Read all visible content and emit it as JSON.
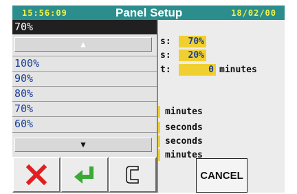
{
  "titlebar": {
    "time": "15:56:09",
    "title": "Panel Setup",
    "date": "18/02/00"
  },
  "background": {
    "row1_suffix": "s:",
    "row1_value": "70%",
    "row2_suffix": "s:",
    "row2_value": "20%",
    "row3_suffix": "t:",
    "row3_value": "0",
    "row3_unit": "minutes",
    "row4_unit": "minutes",
    "row5_unit": "seconds",
    "row6_unit": "seconds",
    "row7_unit": "minutes",
    "cancel_label": "CANCEL"
  },
  "dropdown": {
    "current_value": "70%",
    "options": [
      "100%",
      "90%",
      "80%",
      "70%",
      "60%"
    ],
    "scroll_up_glyph": "▲",
    "scroll_down_glyph": "▼"
  },
  "buttons": {
    "reject_icon": "x-icon",
    "enter_icon": "enter-icon",
    "clear_icon": "clear-c-icon"
  },
  "colors": {
    "titlebar": "#2b8e8c",
    "value_box": "#f0d030",
    "value_text": "#1a3e9a",
    "reject": "#e02020",
    "enter": "#3aaa35"
  }
}
